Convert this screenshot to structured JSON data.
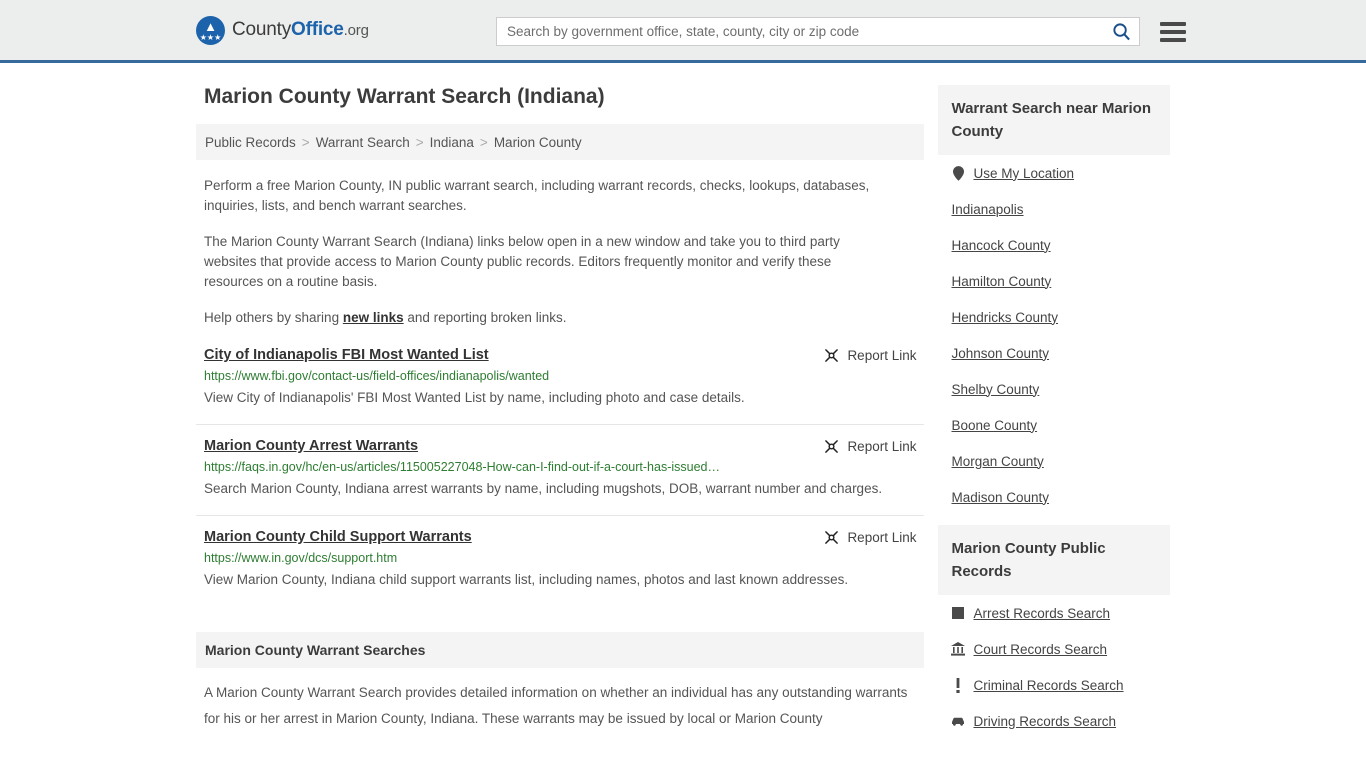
{
  "header": {
    "logo": {
      "text_1": "County",
      "text_2": "Office",
      "text_3": ".org",
      "icon": "eagle-seal-icon"
    },
    "search": {
      "value": "",
      "placeholder": "Search by government office, state, county, city or zip code",
      "button_icon": "search-icon"
    },
    "menu_icon": "hamburger-menu-icon"
  },
  "page": {
    "title": "Marion County Warrant Search (Indiana)",
    "breadcrumb": [
      "Public Records",
      "Warrant Search",
      "Indiana",
      "Marion County"
    ],
    "breadcrumb_separator": ">",
    "intro": [
      "Perform a free Marion County, IN public warrant search, including warrant records, checks, lookups, databases, inquiries, lists, and bench warrant searches.",
      "The Marion County Warrant Search (Indiana) links below open in a new window and take you to third party websites that provide access to Marion County public records. Editors frequently monitor and verify these resources on a routine basis."
    ],
    "help_text_before": "Help others by sharing ",
    "help_link": "new links",
    "help_text_after": " and reporting broken links."
  },
  "results": {
    "report_label": "Report Link",
    "report_icon": "broken-link-icon",
    "items": [
      {
        "title": "City of Indianapolis FBI Most Wanted List",
        "url": "https://www.fbi.gov/contact-us/field-offices/indianapolis/wanted",
        "description": "View City of Indianapolis' FBI Most Wanted List by name, including photo and case details."
      },
      {
        "title": "Marion County Arrest Warrants",
        "url": "https://faqs.in.gov/hc/en-us/articles/115005227048-How-can-I-find-out-if-a-court-has-issued…",
        "description": "Search Marion County, Indiana arrest warrants by name, including mugshots, DOB, warrant number and charges."
      },
      {
        "title": "Marion County Child Support Warrants",
        "url": "https://www.in.gov/dcs/support.htm",
        "description": "View Marion County, Indiana child support warrants list, including names, photos and last known addresses."
      }
    ]
  },
  "bottom_section": {
    "heading": "Marion County Warrant Searches",
    "body": "A Marion County Warrant Search provides detailed information on whether an individual has any outstanding warrants for his or her arrest in Marion County, Indiana. These warrants may be issued by local or Marion County"
  },
  "sidebar": {
    "nearby": {
      "heading": "Warrant Search near Marion County",
      "items": [
        {
          "label": "Use My Location",
          "icon": "map-pin-icon"
        },
        {
          "label": "Indianapolis",
          "icon": ""
        },
        {
          "label": "Hancock County",
          "icon": ""
        },
        {
          "label": "Hamilton County",
          "icon": ""
        },
        {
          "label": "Hendricks County",
          "icon": ""
        },
        {
          "label": "Johnson County",
          "icon": ""
        },
        {
          "label": "Shelby County",
          "icon": ""
        },
        {
          "label": "Boone County",
          "icon": ""
        },
        {
          "label": "Morgan County",
          "icon": ""
        },
        {
          "label": "Madison County",
          "icon": ""
        }
      ]
    },
    "public_records": {
      "heading": "Marion County Public Records",
      "items": [
        {
          "label": "Arrest Records Search",
          "icon": "square-badge-icon"
        },
        {
          "label": "Court Records Search",
          "icon": "courthouse-icon"
        },
        {
          "label": "Criminal Records Search",
          "icon": "exclamation-icon"
        },
        {
          "label": "Driving Records Search",
          "icon": "car-icon"
        }
      ]
    }
  },
  "colors": {
    "header_bg": "#eceded",
    "header_border": "#36699c",
    "brand_blue": "#1d63ab",
    "url_green": "#2e7d32",
    "panel_gray": "#f4f4f4"
  }
}
